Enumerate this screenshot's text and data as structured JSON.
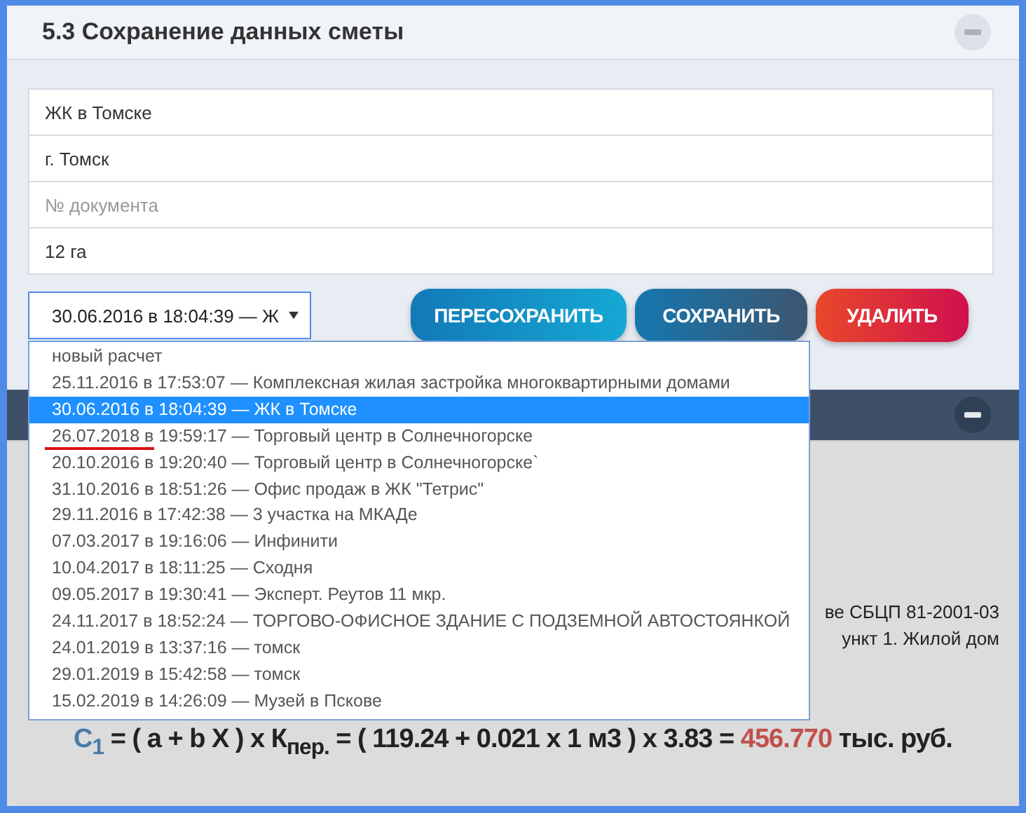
{
  "section": {
    "title": "5.3 Сохранение данных сметы"
  },
  "fields": [
    {
      "value": "ЖК в Томске"
    },
    {
      "value": "г. Томск"
    },
    {
      "placeholder": "№ документа"
    },
    {
      "value": "12 га"
    }
  ],
  "select": {
    "value": "30.06.2016 в 18:04:39 — Ж",
    "expanded": true
  },
  "buttons": [
    {
      "label": "ПЕРЕСОХРАНИТЬ",
      "kind": "resave"
    },
    {
      "label": "СОХРАНИТЬ",
      "kind": "save"
    },
    {
      "label": "УДАЛИТЬ",
      "kind": "delete"
    }
  ],
  "options": [
    {
      "label": "новый расчет",
      "selected": false
    },
    {
      "label": "25.11.2016 в 17:53:07 — Комплексная жилая застройка многоквартирными домами",
      "selected": false
    },
    {
      "label": "30.06.2016 в 18:04:39 — ЖК в Томске",
      "selected": true
    },
    {
      "underlined_part": "26.07.2018 в",
      "label": "19:59:17 — Торговый центр в Солнечногорске",
      "selected": false
    },
    {
      "label": "20.10.2016 в 19:20:40 — Торговый центр в Солнечногорске`",
      "selected": false
    },
    {
      "label": "31.10.2016 в 18:51:26 — Офис продаж в ЖК \"Тетрис\"",
      "selected": false
    },
    {
      "label": "29.11.2016 в 17:42:38 — 3 участка на МКАДе",
      "selected": false
    },
    {
      "label": "07.03.2017 в 19:16:06 — Инфинити",
      "selected": false
    },
    {
      "label": "10.04.2017 в 18:11:25 — Сходня",
      "selected": false
    },
    {
      "label": "09.05.2017 в 19:30:41 — Эксперт. Реутов 11 мкр.",
      "selected": false
    },
    {
      "label": "24.11.2017 в 18:52:24 — ТОРГОВО-ОФИСНОЕ ЗДАНИЕ С ПОДЗЕМНОЙ АВТОСТОЯНКОЙ",
      "selected": false
    },
    {
      "label": "24.01.2019 в 13:37:16 — томск",
      "selected": false
    },
    {
      "label": "29.01.2019 в 15:42:58 — томск",
      "selected": false
    },
    {
      "label": "15.02.2019 в 14:26:09 — Музей в Пскове",
      "selected": false
    }
  ],
  "background": {
    "lines": [
      "ве СБЦП 81-2001-03",
      "ункт 1. Жилой дом"
    ]
  },
  "formula": {
    "lhs": "C$_{1}$",
    "expression": "= ( a + b X ) x К$_{пер.}$ = ( 119.24 + 0.021 x 1 м3 ) x 3.83 =",
    "result": "456.770",
    "unit": "тыс. руб."
  }
}
